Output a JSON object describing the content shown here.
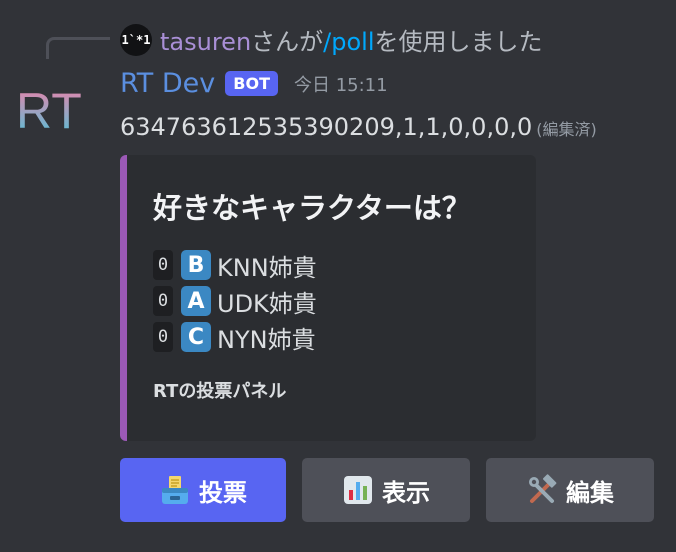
{
  "reply": {
    "avatar_text": "1`*1",
    "user": "tasuren",
    "text_before": "さんが",
    "command": "/poll",
    "text_after": "を使用しました"
  },
  "message": {
    "avatar_text": "RT",
    "username": "RT Dev",
    "badge": "BOT",
    "timestamp": "今日 15:11",
    "content": "634763612535390209,1,1,0,0,0,0",
    "edited": "(編集済)"
  },
  "embed": {
    "accent_color": "#9b59b6",
    "title": "好きなキャラクターは？",
    "choices": [
      {
        "count": "0",
        "letter": "B",
        "label": "KNN姉貴"
      },
      {
        "count": "0",
        "letter": "A",
        "label": "UDK姉貴"
      },
      {
        "count": "0",
        "letter": "C",
        "label": "NYN姉貴"
      }
    ],
    "footer": "RTの投票パネル"
  },
  "buttons": [
    {
      "label": "投票",
      "icon": "ballot-box-icon",
      "style": "primary"
    },
    {
      "label": "表示",
      "icon": "bar-chart-icon",
      "style": "secondary"
    },
    {
      "label": "編集",
      "icon": "hammer-wrench-icon",
      "style": "secondary"
    }
  ]
}
